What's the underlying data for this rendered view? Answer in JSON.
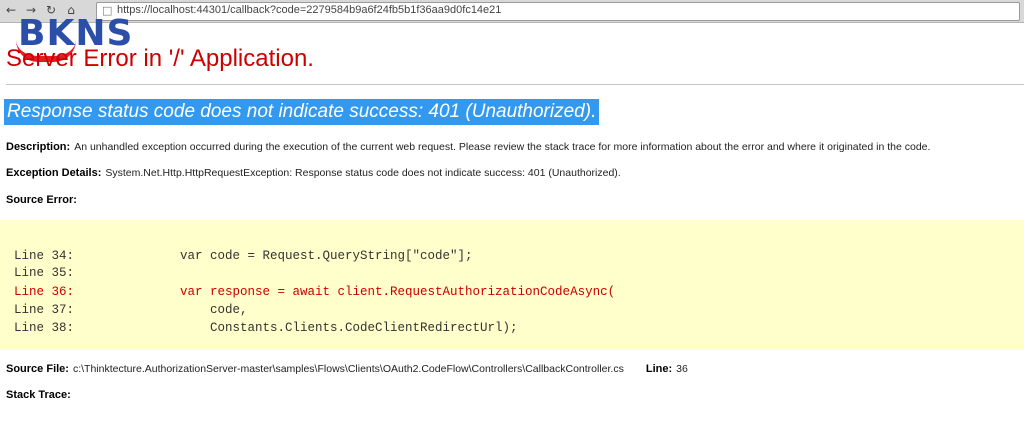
{
  "browser": {
    "back_icon": "arrow-left",
    "forward_icon": "arrow-right",
    "refresh_icon": "refresh",
    "home_icon": "home",
    "url": "https://localhost:44301/callback?code=2279584b9a6f24fb5b1f36aa9d0fc14e21"
  },
  "logo": {
    "text": "BKNS",
    "color": "#2b4fa8",
    "accent": "#e31b23"
  },
  "error_page": {
    "title": "Server Error in '/' Application.",
    "headline": "Response status code does not indicate success: 401 (Unauthorized).",
    "description_label": "Description:",
    "description_text": "An unhandled exception occurred during the execution of the current web request. Please review the stack trace for more information about the error and where it originated in the code.",
    "exception_label": "Exception Details:",
    "exception_text": "System.Net.Http.HttpRequestException: Response status code does not indicate success: 401 (Unauthorized).",
    "source_error_label": "Source Error:",
    "source_lines": [
      {
        "label": "Line 34:",
        "code": "var code = Request.QueryString[\"code\"];",
        "error": false
      },
      {
        "label": "Line 35:",
        "code": "",
        "error": false
      },
      {
        "label": "Line 36:",
        "code": "var response = await client.RequestAuthorizationCodeAsync(",
        "error": true
      },
      {
        "label": "Line 37:",
        "code": "    code,",
        "error": false
      },
      {
        "label": "Line 38:",
        "code": "    Constants.Clients.CodeClientRedirectUrl);",
        "error": false
      }
    ],
    "source_file_label": "Source File:",
    "source_file_path": "c:\\Thinktecture.AuthorizationServer-master\\samples\\Flows\\Clients\\OAuth2.CodeFlow\\Controllers\\CallbackController.cs",
    "line_label": "Line:",
    "line_value": "36",
    "stack_trace_label": "Stack Trace:"
  },
  "colors": {
    "title": "#cc0000",
    "headline_bg": "#3399ee",
    "code_bg": "#ffffcc",
    "error_line": "#cc0000"
  }
}
